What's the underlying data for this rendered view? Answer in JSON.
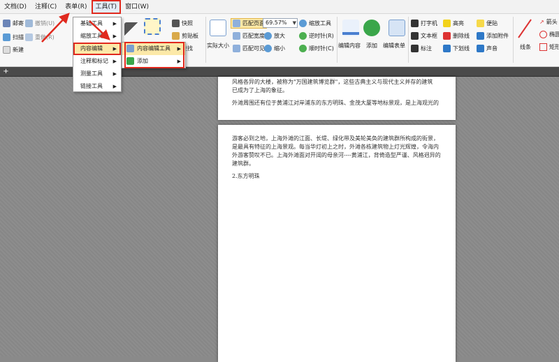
{
  "menubar": [
    "文档(D)",
    "注释(C)",
    "表单(R)",
    "工具(T)",
    "窗口(W)"
  ],
  "ribbon": {
    "mail": "邮寄",
    "scan": "扫描",
    "new": "新建",
    "undo": "撤销(U)",
    "redo": "重做(R)",
    "snapshot": "快照",
    "clipboard": "剪贴板",
    "find": "查找",
    "actual_size": "实际大小",
    "fit_page": "匹配页面",
    "fit_width": "匹配宽度",
    "fit_visible": "匹配可见",
    "zoom_value": "69.57%",
    "zoom_tool": "缩放工具",
    "zoom_in": "放大",
    "zoom_out": "缩小",
    "rotate_ccw": "逆时针(R)",
    "rotate_cw": "顺时针(C)",
    "edit_content": "编辑内容",
    "add": "添加",
    "edit_form": "编辑表单",
    "typewriter": "打字机",
    "textbox": "文本框",
    "callout": "标注",
    "highlight": "高亮",
    "strikeout": "删除线",
    "underline": "下划线",
    "note": "便贴",
    "attach_file": "添加附件",
    "sound": "声音",
    "line": "线条",
    "arrow": "箭头",
    "ellipse": "椭圆",
    "rect": "矩形"
  },
  "tools_menu": [
    "基础工具",
    "缩放工具",
    "内容编辑",
    "注释和标记",
    "测量工具",
    "链接工具"
  ],
  "content_edit_submenu": [
    "内容编辑工具",
    "添加"
  ],
  "page1": {
    "line1": "风格各异的大楼，被称为\"万国建筑博览群\"，这些古典主义与现代主义并存的建筑",
    "line2": "已成为了上海的象征。",
    "para2": "外滩周围还有位于黄浦江对岸浦东的东方明珠、金茂大厦等地标景观，是上海观光的"
  },
  "page2": {
    "para1": "游客必到之地，上海外滩的江面、长堤、绿化带及美轮美奂的建筑群所构成的街景，是最具有特征的上海景观。每当华灯初上之时，外滩各栋建筑物上灯光辉煌，令海内外游客赞叹不已。上海外滩面对开阔的母亲河----黄浦江，背倚造型严谨、风格迥异的建筑群。",
    "heading": "2.东方明珠"
  }
}
